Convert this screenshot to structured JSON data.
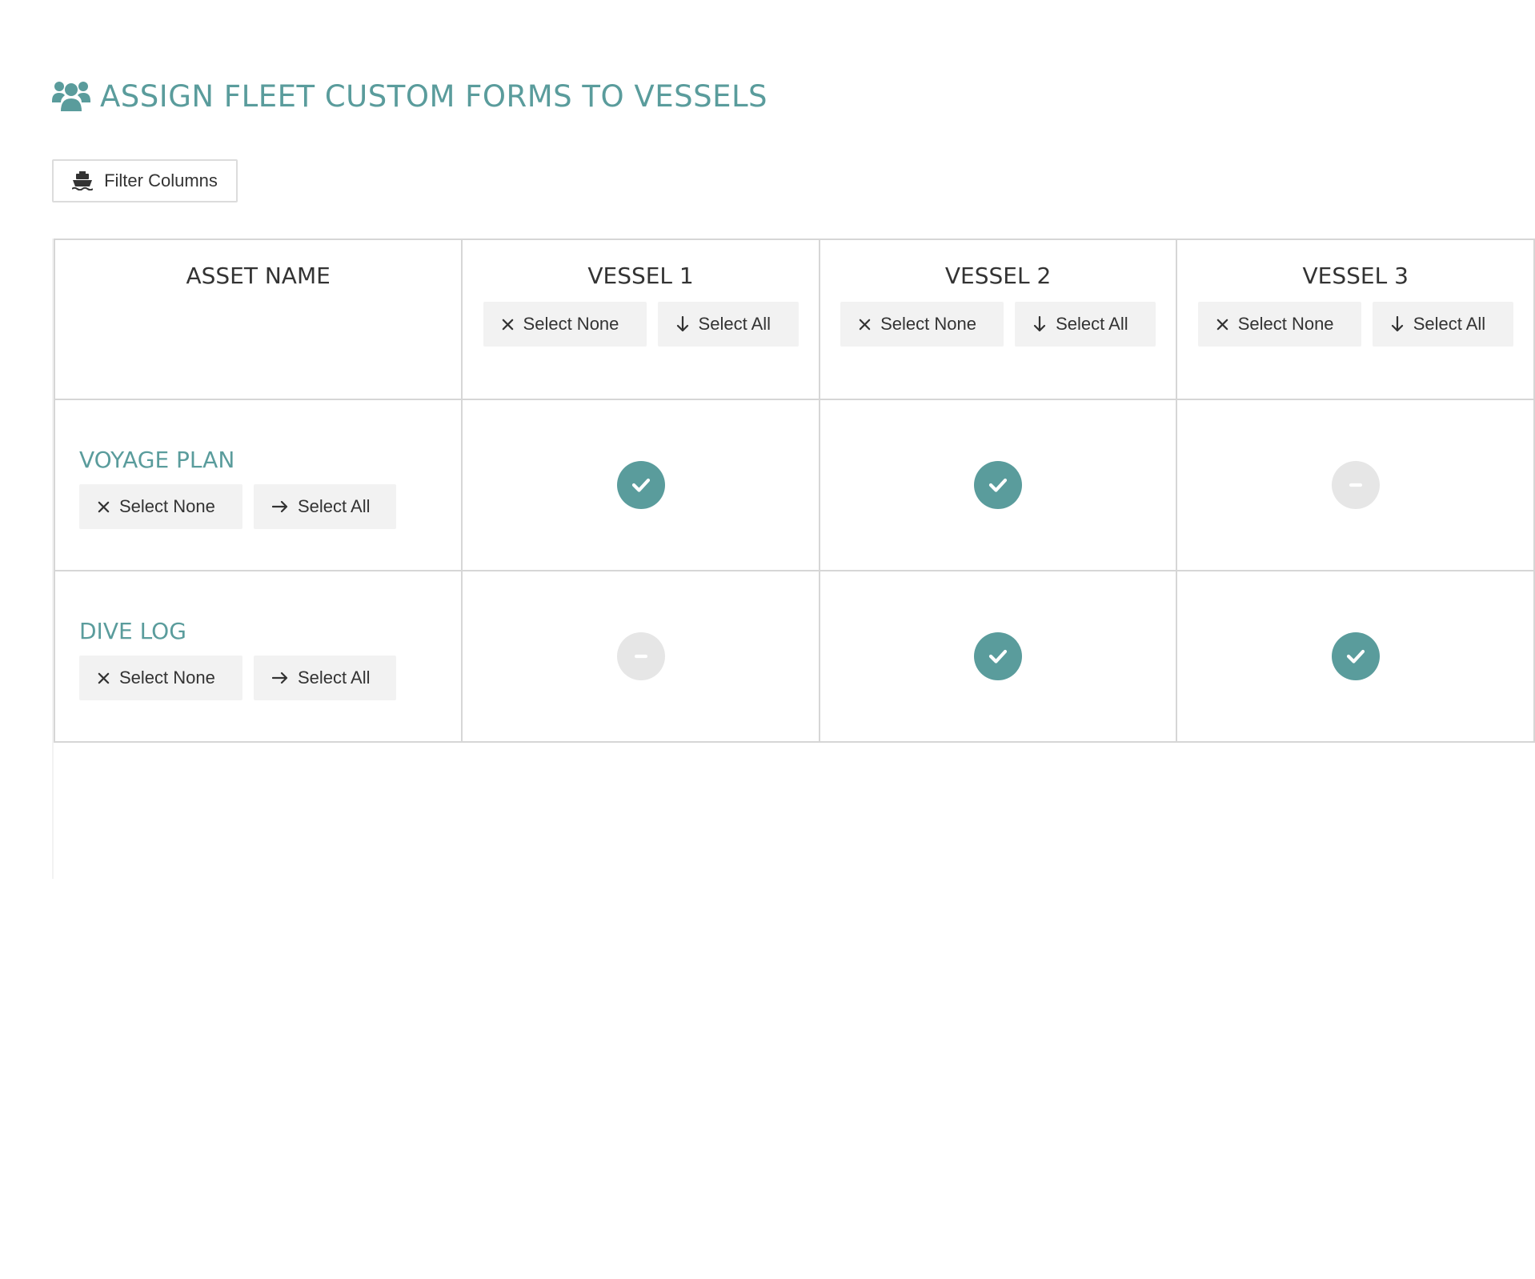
{
  "page": {
    "title": "ASSIGN FLEET CUSTOM FORMS TO VESSELS",
    "title_icon": "users-icon",
    "accent_color": "#5a9c9c"
  },
  "filter": {
    "label": "Filter Columns",
    "icon": "ship-icon"
  },
  "table": {
    "asset_header": "ASSET NAME",
    "columns": [
      {
        "label": "VESSEL 1",
        "select_none": "Select None",
        "select_all": "Select All"
      },
      {
        "label": "VESSEL 2",
        "select_none": "Select None",
        "select_all": "Select All"
      },
      {
        "label": "VESSEL 3",
        "select_none": "Select None",
        "select_all": "Select All"
      }
    ],
    "rows": [
      {
        "name": "VOYAGE PLAN",
        "select_none": "Select None",
        "select_all": "Select All",
        "assigned": [
          true,
          true,
          false
        ]
      },
      {
        "name": "DIVE LOG",
        "select_none": "Select None",
        "select_all": "Select All",
        "assigned": [
          false,
          true,
          true
        ]
      }
    ]
  },
  "status_colors": {
    "assigned": "#5a9c9c",
    "unassigned": "#e6e6e6"
  }
}
